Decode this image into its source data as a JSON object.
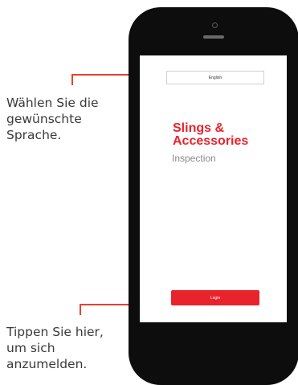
{
  "callouts": {
    "language": "Wählen Sie die\ngewünschte\nSprache.",
    "login": "Tippen Sie hier,\num sich\nanzumelden."
  },
  "screen": {
    "language_value": "English",
    "title": "Slings &\nAccessories",
    "subtitle": "Inspection",
    "login_label": "Login"
  },
  "colors": {
    "brand_red": "#e8232c",
    "leader_line": "#e8412c",
    "phone_body": "#0d0d0d"
  },
  "icons": [
    "camera-icon",
    "speaker-grille"
  ]
}
